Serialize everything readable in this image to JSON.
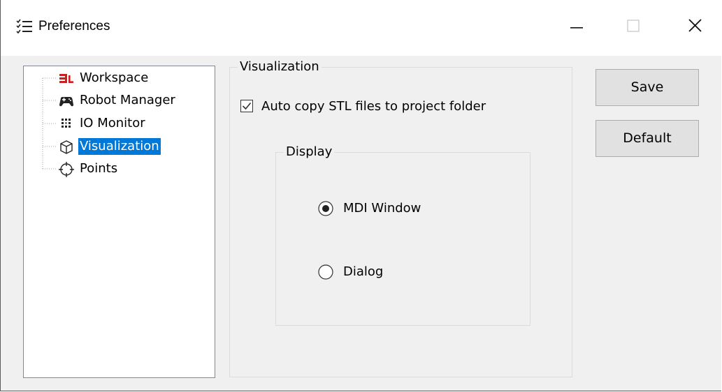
{
  "window": {
    "title": "Preferences",
    "title_icon": "checklist-icon",
    "controls": {
      "minimize_icon": "minimize-icon",
      "maximize_icon": "maximize-icon",
      "close_icon": "close-icon"
    }
  },
  "tree": {
    "items": [
      {
        "label": "Workspace",
        "icon": "workspace-logo-icon",
        "selected": false
      },
      {
        "label": "Robot Manager",
        "icon": "gamepad-icon",
        "selected": false
      },
      {
        "label": "IO Monitor",
        "icon": "io-grid-icon",
        "selected": false
      },
      {
        "label": "Visualization",
        "icon": "cube-icon",
        "selected": true
      },
      {
        "label": "Points",
        "icon": "crosshair-icon",
        "selected": false
      }
    ]
  },
  "visualization": {
    "group_title": "Visualization",
    "auto_copy": {
      "label": "Auto copy STL files to project folder",
      "checked": true
    },
    "display": {
      "group_title": "Display",
      "options": [
        {
          "label": "MDI Window",
          "selected": true
        },
        {
          "label": "Dialog",
          "selected": false
        }
      ]
    }
  },
  "buttons": {
    "save": "Save",
    "default": "Default"
  },
  "colors": {
    "selection": "#0078d7",
    "accent_red": "#cc1f1f",
    "button_face": "#e1e1e1"
  }
}
